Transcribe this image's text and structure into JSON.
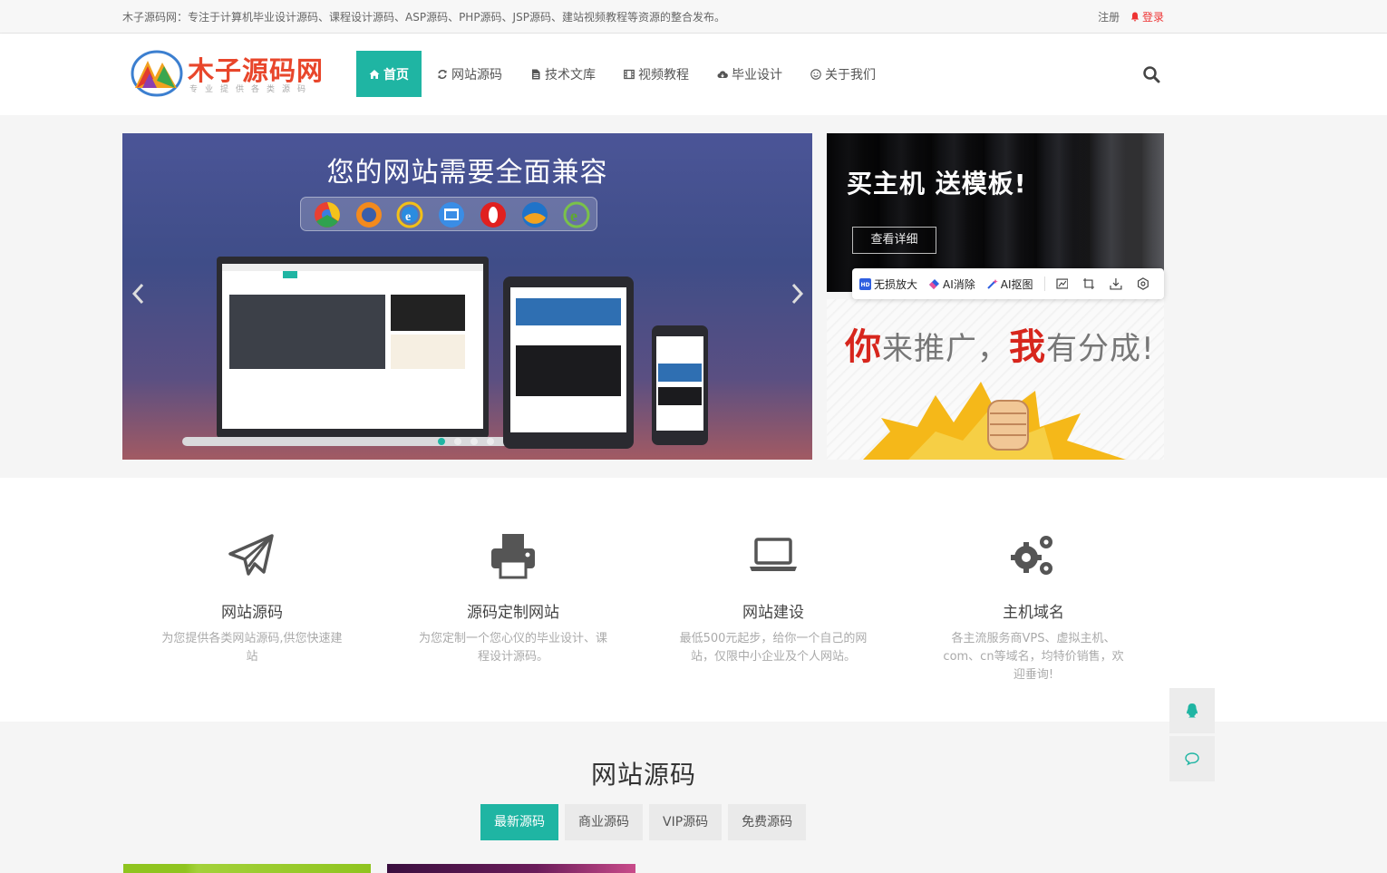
{
  "topbar": {
    "intro": "木子源码网：专注于计算机毕业设计源码、课程设计源码、ASP源码、PHP源码、JSP源码、建站视频教程等资源的整合发布。",
    "register": "注册",
    "login": "登录"
  },
  "logo": {
    "name": "木子源码网",
    "tagline": "专业提供各类源码"
  },
  "nav": {
    "items": [
      {
        "label": "首页",
        "icon": "home-icon"
      },
      {
        "label": "网站源码",
        "icon": "refresh-icon"
      },
      {
        "label": "技术文库",
        "icon": "document-icon"
      },
      {
        "label": "视频教程",
        "icon": "film-icon"
      },
      {
        "label": "毕业设计",
        "icon": "cloud-download-icon"
      },
      {
        "label": "关于我们",
        "icon": "smile-icon"
      }
    ]
  },
  "slider": {
    "headline": "您的网站需要全面兼容"
  },
  "side_top": {
    "title": "买主机 送模板!",
    "button": "查看详细"
  },
  "image_toolbar": {
    "tools": [
      "无损放大",
      "AI消除",
      "AI抠图"
    ]
  },
  "side_bottom": {
    "promo_a": "你",
    "promo_b": "来推广，",
    "promo_c": "我",
    "promo_d": "有分成!"
  },
  "services": [
    {
      "name": "网站源码",
      "desc": "为您提供各类网站源码,供您快速建站",
      "icon": "paper-plane-icon"
    },
    {
      "name": "源码定制网站",
      "desc": "为您定制一个您心仪的毕业设计、课程设计源码。",
      "icon": "printer-icon"
    },
    {
      "name": "网站建设",
      "desc": "最低500元起步，给你一个自己的网站，仅限中小企业及个人网站。",
      "icon": "laptop-icon"
    },
    {
      "name": "主机域名",
      "desc": "各主流服务商VPS、虚拟主机、com、cn等域名，均特价销售，欢迎垂询!",
      "icon": "gears-icon"
    }
  ],
  "source_section": {
    "title": "网站源码",
    "tabs": [
      "最新源码",
      "商业源码",
      "VIP源码",
      "免费源码"
    ]
  },
  "colors": {
    "accent": "#1fb5a3",
    "login_red": "#ee3333",
    "promo_red": "#d7261d"
  }
}
